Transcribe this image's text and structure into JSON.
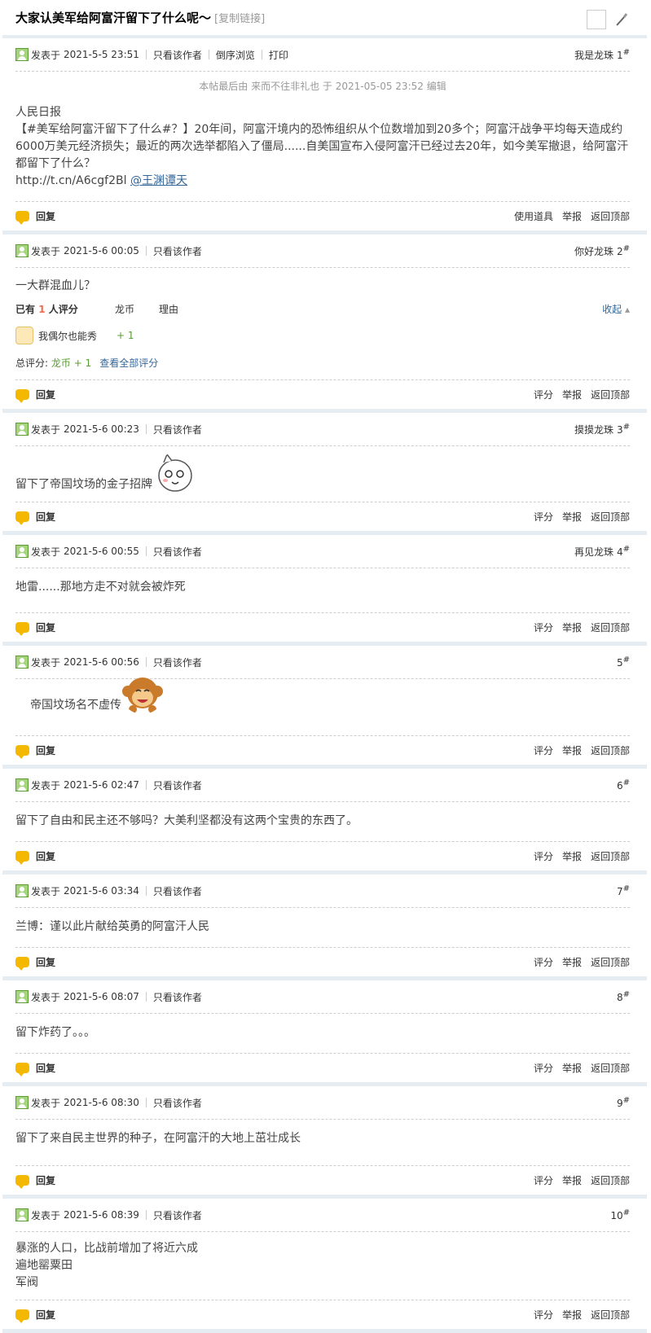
{
  "thread": {
    "title": "大家认美军给阿富汗留下了什么呢～",
    "copy_link": "[复制链接]"
  },
  "labels": {
    "posted_at": "发表于",
    "only_author": "只看该作者",
    "reverse": "倒序浏览",
    "print": "打印",
    "reply": "回复",
    "use_tool": "使用道具",
    "rate": "评分",
    "report": "举报",
    "back_top": "返回顶部"
  },
  "posts": [
    {
      "date": "2021-5-5 23:51",
      "nick": "我是龙珠",
      "floor": "1",
      "edit_note": "本帖最后由 来而不往非礼也 于 2021-05-05 23:52 编辑",
      "lines": [
        "人民日报",
        "【#美军给阿富汗留下了什么#？】20年间，阿富汗境内的恐怖组织从个位数增加到20多个；阿富汗战争平均每天造成约6000万美元经济损失；最近的两次选举都陷入了僵局......自美国宣布入侵阿富汗已经过去20年，如今美军撤退，给阿富汗都留下了什么？"
      ],
      "link_text": "http://t.cn/A6cgf2Bl",
      "mention": "@王渊谭天"
    },
    {
      "date": "2021-5-6 00:05",
      "nick": "你好龙珠",
      "floor": "2",
      "text": "一大群混血儿？",
      "rating": {
        "count_prefix": "已有",
        "count": "1",
        "count_suffix": "人评分",
        "col1": "龙币",
        "col2": "理由",
        "collapse": "收起",
        "rater": "我偶尔也能秀",
        "plus": "+ 1",
        "total_label": "总评分:",
        "total_value": "龙币 + 1",
        "view_all": "查看全部评分"
      }
    },
    {
      "date": "2021-5-6 00:23",
      "nick": "摸摸龙珠",
      "floor": "3",
      "text": "留下了帝国坟场的金子招牌"
    },
    {
      "date": "2021-5-6 00:55",
      "nick": "再见龙珠",
      "floor": "4",
      "text": "地雷......那地方走不对就会被炸死"
    },
    {
      "date": "2021-5-6 00:56",
      "nick": "",
      "floor": "5",
      "text": "帝国坟场名不虚传"
    },
    {
      "date": "2021-5-6 02:47",
      "nick": "",
      "floor": "6",
      "text": "留下了自由和民主还不够吗？大美利坚都没有这两个宝贵的东西了。"
    },
    {
      "date": "2021-5-6 03:34",
      "nick": "",
      "floor": "7",
      "text": "兰博：谨以此片献给英勇的阿富汗人民"
    },
    {
      "date": "2021-5-6 08:07",
      "nick": "",
      "floor": "8",
      "text": "留下炸药了。。。"
    },
    {
      "date": "2021-5-6 08:30",
      "nick": "",
      "floor": "9",
      "text": "留下了来自民主世界的种子，在阿富汗的大地上茁壮成长"
    },
    {
      "date": "2021-5-6 08:39",
      "nick": "",
      "floor": "10",
      "lines": [
        "暴涨的人口，比战前增加了将近六成",
        "遍地罂粟田",
        "军阀"
      ]
    }
  ],
  "floor_mark": "#",
  "icons": {
    "user": "user-icon",
    "reply": "reply-bubble-icon",
    "edit": "pen-icon",
    "emoji_face": "emoji-rabbit-face-icon",
    "emoji_monkey": "emoji-monkey-icon"
  }
}
